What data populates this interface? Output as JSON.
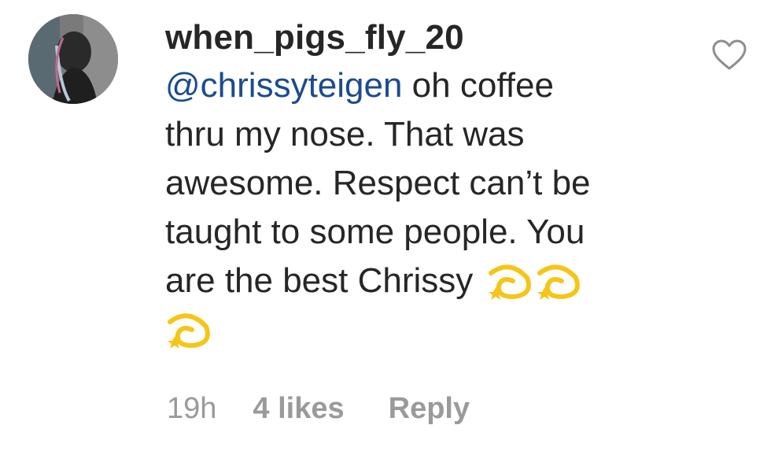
{
  "comment": {
    "username": "when_pigs_fly_20",
    "mention": "@chrissyteigen",
    "lines": [
      " oh coffee",
      "thru my nose. That was",
      "awesome. Respect can’t be",
      "taught to some people. You",
      "are the best Chrissy "
    ],
    "emoji": [
      "dizzy-emoji",
      "dizzy-emoji",
      "dizzy-emoji"
    ],
    "meta": {
      "time": "19h",
      "likes": "4 likes",
      "reply": "Reply"
    },
    "like_icon": "heart-outline-icon"
  },
  "colors": {
    "text": "#262626",
    "mention": "#1c4b8f",
    "meta": "#9a9a9a",
    "emoji": "#f5c518"
  }
}
